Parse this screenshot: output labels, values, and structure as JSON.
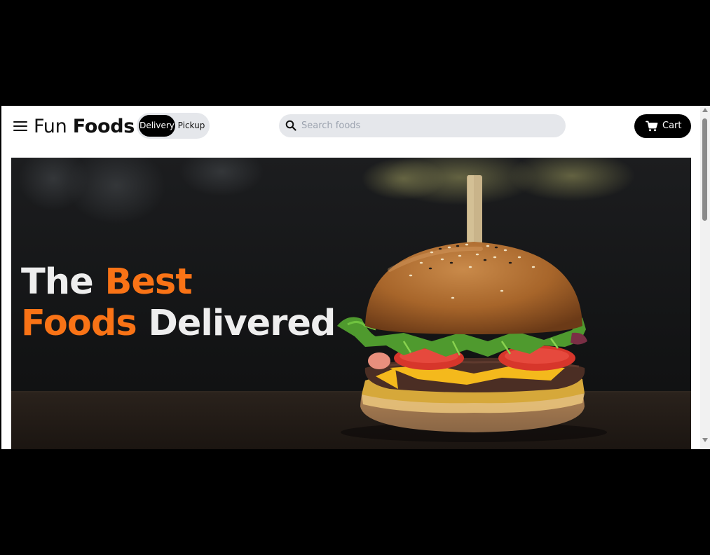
{
  "header": {
    "logo_light": "Fun",
    "logo_bold": "Foods",
    "mode_toggle": {
      "active": "Delivery",
      "inactive": "Pickup"
    },
    "search": {
      "placeholder": "Search foods",
      "value": ""
    },
    "cart_label": "Cart"
  },
  "hero": {
    "line1_plain": "The ",
    "line1_accent": "Best",
    "line2_accent": "Foods",
    "line2_plain": " Delivered",
    "accent_color": "#f97316"
  },
  "icons": {
    "menu": "hamburger-menu-icon",
    "search": "search-icon",
    "cart": "cart-icon"
  }
}
